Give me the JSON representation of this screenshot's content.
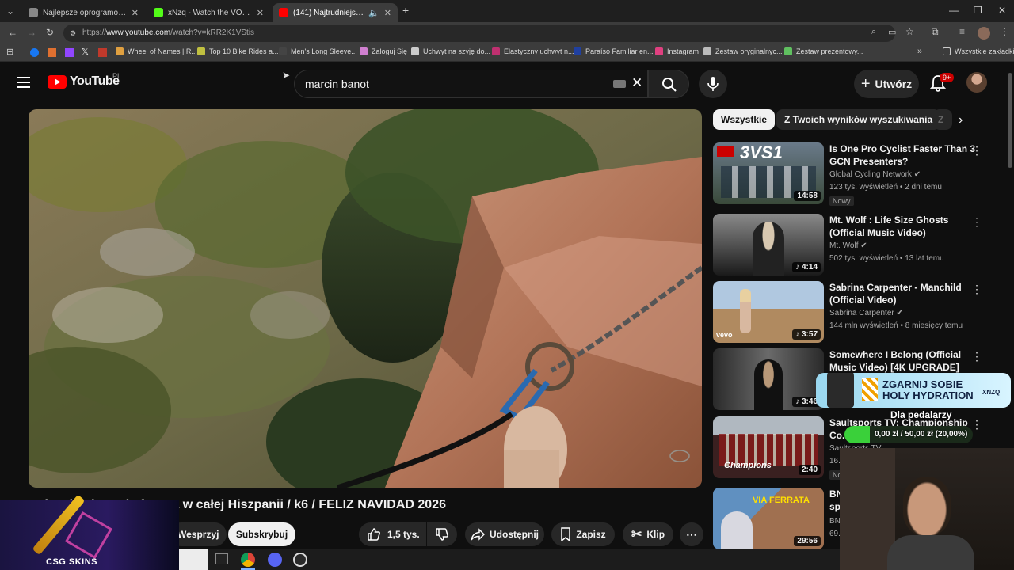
{
  "browser": {
    "tabs": [
      {
        "title": "Najlepsze oprogramowanie do",
        "color": "#888888"
      },
      {
        "title": "xNzq - Watch the VOD on Kick",
        "color": "#53fc18"
      },
      {
        "title": "(141) Najtrudniejsza via fer",
        "color": "#ff0000"
      }
    ],
    "new_tab": "+",
    "url_prefix": "https://",
    "url_host": "www.youtube.com",
    "url_path": "/watch?v=kRR2K1VStis",
    "bookmarks": [
      {
        "label": "Wheel of Names | R...",
        "color": "#e0a040"
      },
      {
        "label": "Top 10 Bike Rides a...",
        "color": "#c0c040"
      },
      {
        "label": "Men's Long Sleeve...",
        "color": "#444444"
      },
      {
        "label": "Zaloguj Się",
        "color": "#d080d0"
      },
      {
        "label": "Uchwyt na szyję do...",
        "color": "#cccccc"
      },
      {
        "label": "Elastyczny uchwyt n...",
        "color": "#c03070"
      },
      {
        "label": "Paraíso Familiar en...",
        "color": "#2040a0"
      },
      {
        "label": "Instagram",
        "color": "#e04080"
      },
      {
        "label": "Zestaw oryginalnyc...",
        "color": "#bbbbbb"
      },
      {
        "label": "Zestaw prezentowy...",
        "color": "#60c060"
      }
    ],
    "all_bookmarks": "Wszystkie zakładki"
  },
  "youtube": {
    "logo": "YouTube",
    "region": "PL",
    "search_value": "marcin banot",
    "create_label": "Utwórz",
    "notif_count": "9+"
  },
  "video": {
    "title": "Najtrudniejsza via ferrata w całej Hiszpanii / k6 / FELIZ NAVIDAD 2026",
    "support_label": "Wesprzyj",
    "subscribe_label": "Subskrybuj",
    "likes": "1,5 tys.",
    "share_label": "Udostępnij",
    "save_label": "Zapisz",
    "clip_label": "Klip",
    "more": "⋯"
  },
  "sidebar": {
    "chips": [
      "Wszystkie",
      "Z Twoich wyników wyszukiwania",
      "Z"
    ],
    "recs": [
      {
        "title": "Is One Pro Cyclist Faster Than 3 GCN Presenters?",
        "channel": "Global Cycling Network",
        "meta": "123 tys. wyświetleń • 2 dni temu",
        "duration": "14:58",
        "badge": "Nowy",
        "thumb_top": "#6a7a8a",
        "thumb_bot": "#3a4a3a",
        "thumb_text": "3VS1"
      },
      {
        "title": "Mt. Wolf : Life Size Ghosts (Official Music Video)",
        "channel": "Mt. Wolf",
        "meta": "502 tys. wyświetleń • 13 lat temu",
        "duration": "4:14",
        "badge": "",
        "thumb_top": "#8a8a8a",
        "thumb_bot": "#1a1a1a",
        "thumb_text": ""
      },
      {
        "title": "Sabrina Carpenter - Manchild (Official Video)",
        "channel": "Sabrina Carpenter",
        "meta": "144 mln wyświetleń • 8 miesięcy temu",
        "duration": "3:57",
        "badge": "",
        "thumb_top": "#b0c8e0",
        "thumb_bot": "#b08a60",
        "thumb_text": "vevo"
      },
      {
        "title": "Somewhere I Belong (Official Music Video) [4K UPGRADE] –...",
        "channel": "",
        "meta": "",
        "duration": "3:46",
        "badge": "",
        "thumb_top": "#2a2a2a",
        "thumb_bot": "#555555",
        "thumb_text": ""
      },
      {
        "title": "Saultsports TV: Championship Co...",
        "channel": "Saultsports TV",
        "meta": "16...",
        "duration": "2:40",
        "badge": "No...",
        "thumb_top": "#b0b8c0",
        "thumb_bot": "#3a2020",
        "thumb_text": "Champions"
      },
      {
        "title": "BN... sp...",
        "channel": "BN...",
        "meta": "69...",
        "duration": "29:56",
        "badge": "",
        "thumb_top": "#6090c0",
        "thumb_bot": "#a07050",
        "thumb_text": "VIA FERRATA"
      }
    ]
  },
  "overlay": {
    "promo_line1": "ZGARNIJ SOBIE",
    "promo_line2": "HOLY HYDRATION",
    "promo_brand": "XNZQ",
    "goal_label": "Dla pedalarzy",
    "goal_value": "0,00 zł / 50,00 zł (20,00%)",
    "goal_fraction": 0.2,
    "csgo_brand": "CSG SKINS"
  }
}
